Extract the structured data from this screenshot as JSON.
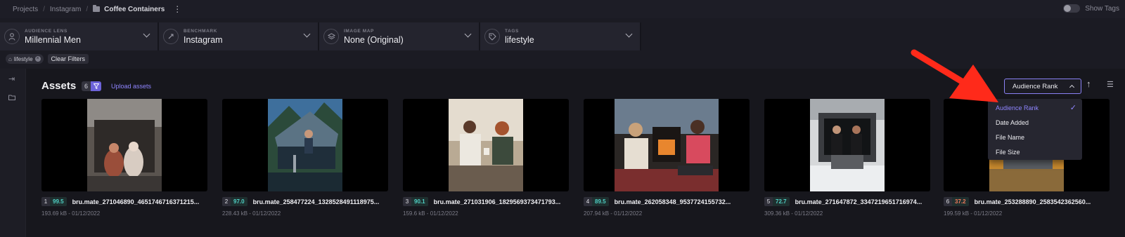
{
  "breadcrumb": {
    "projects": "Projects",
    "instagram": "Instagram",
    "current": "Coffee Containers"
  },
  "show_tags_label": "Show Tags",
  "filters": [
    {
      "label": "AUDIENCE LENS",
      "value": "Millennial Men",
      "icon": "person-icon"
    },
    {
      "label": "BENCHMARK",
      "value": "Instagram",
      "icon": "benchmark-icon"
    },
    {
      "label": "IMAGE MAP",
      "value": "None (Original)",
      "icon": "layers-icon"
    },
    {
      "label": "TAGS",
      "value": "lifestyle",
      "icon": "tag-icon"
    }
  ],
  "chips": {
    "tag": "lifestyle",
    "clear": "Clear Filters"
  },
  "assets": {
    "title": "Assets",
    "count": "6",
    "upload": "Upload assets"
  },
  "sort": {
    "selected": "Audience Rank",
    "options": [
      "Audience Rank",
      "Date Added",
      "File Name",
      "File Size"
    ]
  },
  "cards": [
    {
      "rank": "1",
      "score": "99.5",
      "score_color": "#4fd1c5",
      "name": "bru.mate_271046890_4651746716371215...",
      "size": "193.69 kB - 01/12/2022"
    },
    {
      "rank": "2",
      "score": "97.0",
      "score_color": "#4fd1c5",
      "name": "bru.mate_258477224_1328528491118975...",
      "size": "228.43 kB - 01/12/2022"
    },
    {
      "rank": "3",
      "score": "90.1",
      "score_color": "#4fd1c5",
      "name": "bru.mate_271031906_1829569373471793...",
      "size": "159.6 kB - 01/12/2022"
    },
    {
      "rank": "4",
      "score": "89.5",
      "score_color": "#4fd1c5",
      "name": "bru.mate_262058348_9537724155732...",
      "size": "207.94 kB - 01/12/2022"
    },
    {
      "rank": "5",
      "score": "72.7",
      "score_color": "#4fd1c5",
      "name": "bru.mate_271647872_3347219651716974...",
      "size": "309.36 kB - 01/12/2022"
    },
    {
      "rank": "6",
      "score": "37.2",
      "score_color": "#f07a5a",
      "name": "bru.mate_253288890_2583542362560...",
      "size": "199.59 kB - 01/12/2022"
    }
  ],
  "colors": {
    "accent": "#8f85ff",
    "annotation_arrow": "#ff2a1a"
  }
}
